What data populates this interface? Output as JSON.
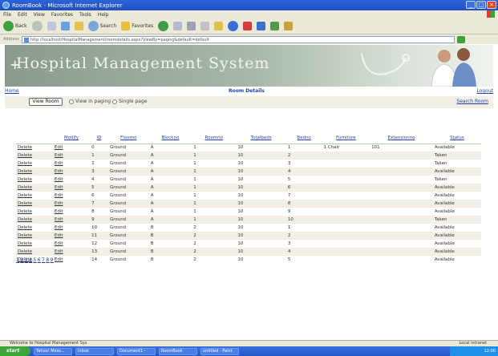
{
  "window": {
    "title": "RoomBook - Microsoft Internet Explorer"
  },
  "menu": [
    "File",
    "Edit",
    "View",
    "Favorites",
    "Tools",
    "Help"
  ],
  "toolbar": {
    "back_label": "Back",
    "search_label": "Search",
    "favorites_label": "Favorites"
  },
  "address": {
    "url": "http://localhost/HospitalManagement/roomdetails.aspx?ViewBy=paging&default=default"
  },
  "banner": {
    "title": "Hospital Management System",
    "cross": "+"
  },
  "nav": {
    "home_label": "Home",
    "heading": "Room Details",
    "logout_label": "Logout"
  },
  "controls": {
    "view_button_label": "View Room",
    "radio_paging_label": "View in paging",
    "radio_single_label": "Single page",
    "search_label": "Search Room"
  },
  "table": {
    "headers": [
      "",
      "Modify",
      "ID",
      "Floorno",
      "Blockno",
      "Roomno",
      "Totalbeds",
      "Bedno",
      "Furniture",
      "Extensionno",
      "Status"
    ],
    "rows": [
      [
        "Delete",
        "Edit",
        "0",
        "Ground",
        "A",
        "1",
        "10",
        "1",
        "1 Chair",
        "101",
        "Available"
      ],
      [
        "Delete",
        "Edit",
        "1",
        "Ground",
        "A",
        "1",
        "10",
        "2",
        "",
        "",
        "Taken"
      ],
      [
        "Delete",
        "Edit",
        "2",
        "Ground",
        "A",
        "1",
        "10",
        "3",
        "",
        "",
        "Taken"
      ],
      [
        "Delete",
        "Edit",
        "3",
        "Ground",
        "A",
        "1",
        "10",
        "4",
        "",
        "",
        "Available"
      ],
      [
        "Delete",
        "Edit",
        "4",
        "Ground",
        "A",
        "1",
        "10",
        "5",
        "",
        "",
        "Taken"
      ],
      [
        "Delete",
        "Edit",
        "5",
        "Ground",
        "A",
        "1",
        "10",
        "6",
        "",
        "",
        "Available"
      ],
      [
        "Delete",
        "Edit",
        "6",
        "Ground",
        "A",
        "1",
        "10",
        "7",
        "",
        "",
        "Available"
      ],
      [
        "Delete",
        "Edit",
        "7",
        "Ground",
        "A",
        "1",
        "10",
        "8",
        "",
        "",
        "Available"
      ],
      [
        "Delete",
        "Edit",
        "8",
        "Ground",
        "A",
        "1",
        "10",
        "9",
        "",
        "",
        "Available"
      ],
      [
        "Delete",
        "Edit",
        "9",
        "Ground",
        "A",
        "1",
        "10",
        "10",
        "",
        "",
        "Taken"
      ],
      [
        "Delete",
        "Edit",
        "10",
        "Ground",
        "B",
        "2",
        "10",
        "1",
        "",
        "",
        "Available"
      ],
      [
        "Delete",
        "Edit",
        "11",
        "Ground",
        "B",
        "2",
        "10",
        "2",
        "",
        "",
        "Available"
      ],
      [
        "Delete",
        "Edit",
        "12",
        "Ground",
        "B",
        "2",
        "10",
        "3",
        "",
        "",
        "Available"
      ],
      [
        "Delete",
        "Edit",
        "13",
        "Ground",
        "B",
        "2",
        "10",
        "4",
        "",
        "",
        "Available"
      ],
      [
        "Delete",
        "Edit",
        "14",
        "Ground",
        "B",
        "2",
        "10",
        "5",
        "",
        "",
        "Available"
      ]
    ]
  },
  "pager": [
    "1",
    "2",
    "3",
    "4",
    "5",
    "6",
    "7",
    "8",
    "9"
  ],
  "status": {
    "left": "Welcome to Hospital Management Sys",
    "right": "Local intranet"
  },
  "taskbar": {
    "start_label": "start",
    "tasks": [
      "Yahoo! Mess...",
      "Inbox",
      "Document1 -",
      "RoomBook",
      "untitled - Paint"
    ],
    "clock": "12:00"
  }
}
